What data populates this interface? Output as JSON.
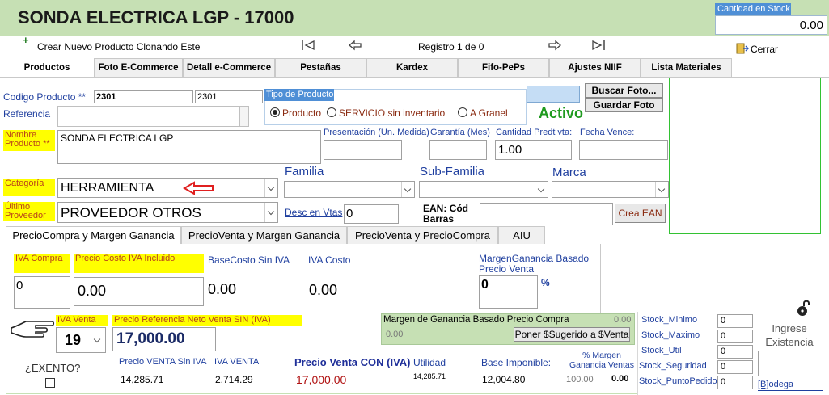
{
  "header": {
    "title": "SONDA ELECTRICA LGP - 17000",
    "stock_label": "Cantidad en Stock",
    "stock_value": "0.00"
  },
  "toolbar": {
    "clone_label": "Crear Nuevo Producto Clonando Este",
    "record_label": "Registro 1 de 0",
    "close_label": "Cerrar"
  },
  "tabs": [
    {
      "label": "Productos"
    },
    {
      "label": "Foto E-Commerce"
    },
    {
      "label": "Detall e-Commerce"
    },
    {
      "label": "Pestañas"
    },
    {
      "label": "Kardex"
    },
    {
      "label": "Fifo-PePs"
    },
    {
      "label": "Ajustes NIIF"
    },
    {
      "label": "Lista Materiales"
    }
  ],
  "product": {
    "code_label": "Codigo Producto **",
    "code_value": "2301",
    "code_value2": "2301",
    "reference_label": "Referencia",
    "name_label": "Nombre Producto **",
    "name_value": "SONDA ELECTRICA LGP",
    "presentation_label": "Presentación (Un. Medida)",
    "warranty_label": "Garantía (Mes)",
    "qty_label": "Cantidad Predt vta:",
    "qty_value": "1.00",
    "expiry_label": "Fecha Vence:",
    "category_label": "Categoría",
    "category_value": "HERRAMIENTA",
    "family_label": "Familia",
    "subfamily_label": "Sub-Familia",
    "brand_label": "Marca",
    "supplier_label": "Último Proveedor",
    "supplier_value": "PROVEEDOR OTROS",
    "discount_label": "Desc en Vtas",
    "discount_value": "0",
    "ean_label": "EAN: Cód Barras",
    "create_ean_label": "Crea EAN"
  },
  "product_type": {
    "label": "Tipo de Producto",
    "options": [
      "Producto",
      "SERVICIO sin inventario",
      "A Granel"
    ],
    "selected": "Producto"
  },
  "status": {
    "label": "Activo",
    "color": "#1f9a1f"
  },
  "photo": {
    "search_label": "Buscar Foto...",
    "save_label": "Guardar Foto"
  },
  "price_tabs": [
    {
      "label": "PrecioCompra y Margen Ganancia"
    },
    {
      "label": "PrecioVenta y Margen Ganancia"
    },
    {
      "label": "PrecioVenta y PrecioCompra"
    },
    {
      "label": "AIU"
    }
  ],
  "purchase": {
    "iva_label": "IVA Compra",
    "iva_value": "0",
    "cost_iva_label": "Precio Costo IVA Incluido",
    "cost_iva_value": "0.00",
    "base_cost_label": "BaseCosto Sin IVA",
    "base_cost_value": "0.00",
    "iva_cost_label": "IVA Costo",
    "iva_cost_value": "0.00",
    "margin_label": "MargenGanancia Basado Precio Venta",
    "margin_value": "0",
    "percent_sign": "%"
  },
  "sale": {
    "iva_label": "IVA Venta",
    "iva_value": "19",
    "ref_price_label": "Precio Referencia Neto Venta SIN (IVA)",
    "ref_price_value": "17,000.00",
    "margin_purchase_label": "Margen de Ganancia Basado Precio Compra",
    "margin_purchase_value": "0.00",
    "margin_purchase_value2": "0.00",
    "suggest_label": "Poner $Sugerido a $Venta",
    "exento_label": "¿EXENTO?",
    "price_no_iva_label": "Precio VENTA Sin IVA",
    "price_no_iva_value": "14,285.71",
    "iva_venta_label": "IVA VENTA",
    "iva_venta_value": "2,714.29",
    "price_iva_label": "Precio Venta CON (IVA)",
    "price_iva_value": "17,000.00",
    "utility_label": "Utilidad",
    "utility_value": "14,285.71",
    "base_label": "Base Imponible:",
    "base_value": "12,004.80",
    "pct_margin_label": "% Margen Ganancia Ventas",
    "pct_margin_value": "100.00",
    "pct_margin_value2": "0.00"
  },
  "stock": {
    "items": [
      {
        "label": "Stock_Minimo",
        "value": "0"
      },
      {
        "label": "Stock_Maximo",
        "value": "0"
      },
      {
        "label": "Stock_Util",
        "value": "0"
      },
      {
        "label": "Stock_Seguridad",
        "value": "0"
      },
      {
        "label": "Stock_PuntoPedido",
        "value": "0"
      }
    ],
    "ingress_label": "Ingrese Existencia",
    "bodega_key": "[B]",
    "bodega_label": "odega"
  }
}
